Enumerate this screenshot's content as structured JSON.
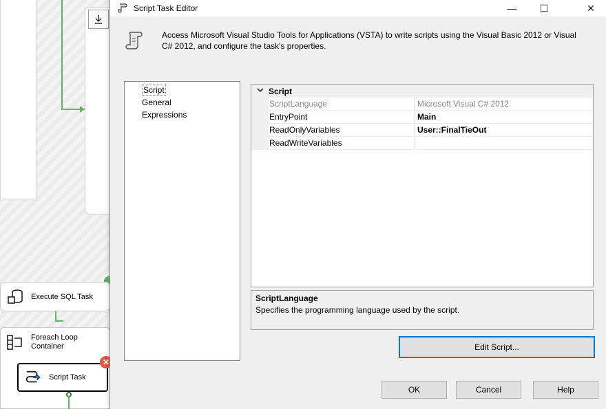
{
  "window": {
    "title": "Script Task Editor",
    "minimize_glyph": "—",
    "maximize_glyph": "☐",
    "close_glyph": "✕"
  },
  "header": {
    "description": "Access Microsoft Visual Studio Tools for Applications (VSTA) to write scripts using the Visual Basic 2012 or Visual C# 2012, and configure the task's properties."
  },
  "nav": {
    "items": [
      {
        "label": "Script",
        "selected": true
      },
      {
        "label": "General",
        "selected": false
      },
      {
        "label": "Expressions",
        "selected": false
      }
    ]
  },
  "property_grid": {
    "category": "Script",
    "rows": [
      {
        "name": "ScriptLanguage",
        "value": "Microsoft Visual C# 2012",
        "readonly": true
      },
      {
        "name": "EntryPoint",
        "value": "Main",
        "bold": true
      },
      {
        "name": "ReadOnlyVariables",
        "value": "User::FinalTieOut",
        "bold": true
      },
      {
        "name": "ReadWriteVariables",
        "value": ""
      }
    ]
  },
  "description_panel": {
    "title": "ScriptLanguage",
    "text": "Specifies the programming language used by the script."
  },
  "buttons": {
    "edit_script": "Edit Script...",
    "ok": "OK",
    "cancel": "Cancel",
    "help": "Help"
  },
  "designer": {
    "tasks": {
      "execute_sql": "Execute SQL Task",
      "foreach": "Foreach Loop Container",
      "script": "Script Task"
    },
    "error_glyph": "✕"
  },
  "colors": {
    "accent": "#0078d7",
    "connector": "#5cb85c",
    "error": "#e8553f"
  }
}
